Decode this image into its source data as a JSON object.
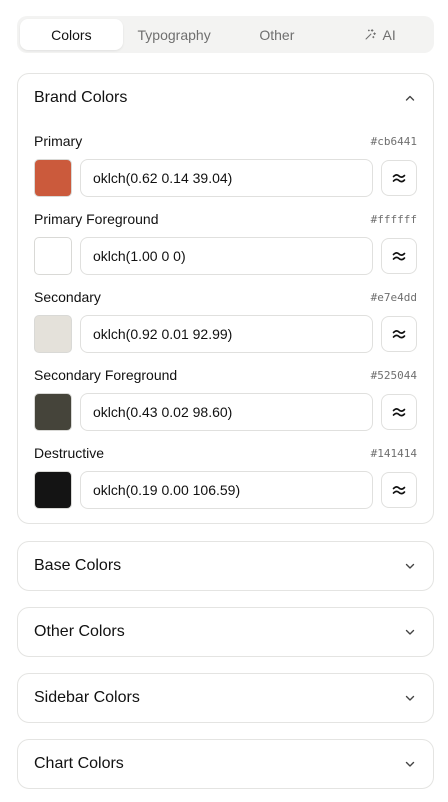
{
  "tabs": [
    {
      "label": "Colors",
      "active": true
    },
    {
      "label": "Typography",
      "active": false
    },
    {
      "label": "Other",
      "active": false
    },
    {
      "label": "AI",
      "active": false,
      "icon": "sparkles-icon"
    }
  ],
  "brand": {
    "title": "Brand Colors",
    "expanded": true,
    "colors": [
      {
        "label": "Primary",
        "hex": "#cb6441",
        "value": "oklch(0.62 0.14 39.04)",
        "swatch": "#cb5a3c"
      },
      {
        "label": "Primary Foreground",
        "hex": "#ffffff",
        "value": "oklch(1.00 0 0)",
        "swatch": "#ffffff"
      },
      {
        "label": "Secondary",
        "hex": "#e7e4dd",
        "value": "oklch(0.92 0.01 92.99)",
        "swatch": "#e4e1da"
      },
      {
        "label": "Secondary Foreground",
        "hex": "#525044",
        "value": "oklch(0.43 0.02 98.60)",
        "swatch": "#45443a"
      },
      {
        "label": "Destructive",
        "hex": "#141414",
        "value": "oklch(0.19 0.00 106.59)",
        "swatch": "#141414"
      }
    ]
  },
  "sections": [
    {
      "title": "Base Colors"
    },
    {
      "title": "Other Colors"
    },
    {
      "title": "Sidebar Colors"
    },
    {
      "title": "Chart Colors"
    }
  ]
}
